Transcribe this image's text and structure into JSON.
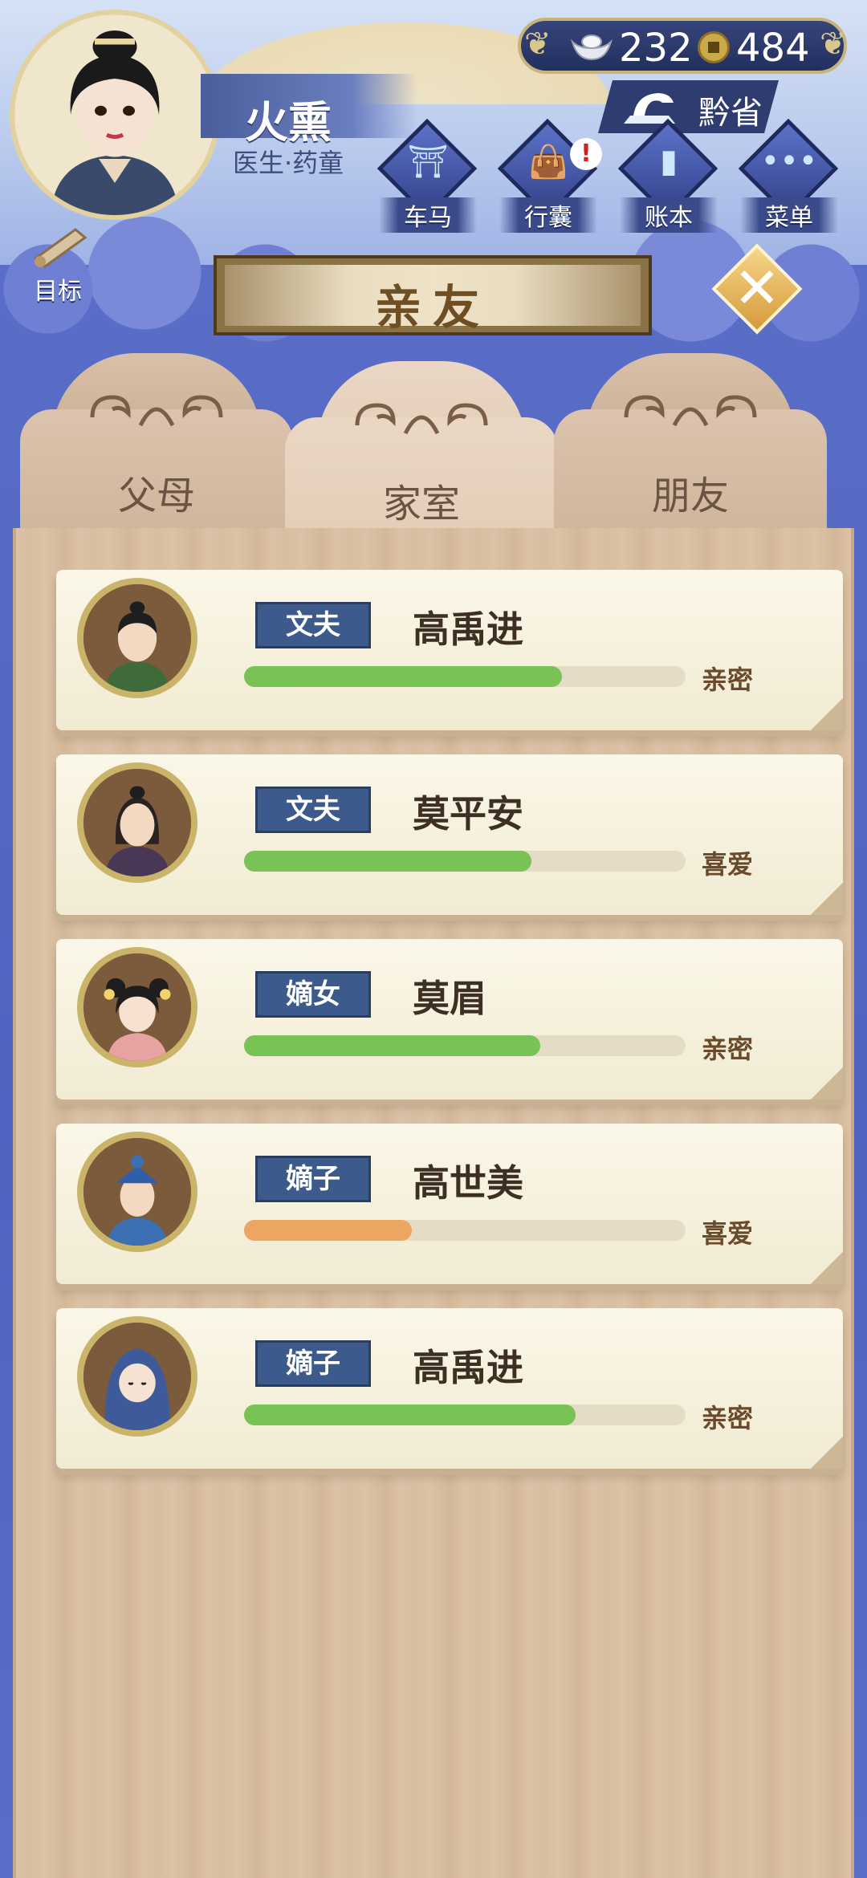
{
  "player": {
    "name": "火熏",
    "title": "医生·药童"
  },
  "currency": {
    "silver": "232",
    "gold": "484"
  },
  "province": "黔省",
  "menu": [
    {
      "label": "车马",
      "icon": "carriage-icon"
    },
    {
      "label": "行囊",
      "icon": "bag-icon",
      "alert": "!"
    },
    {
      "label": "账本",
      "icon": "ledger-icon"
    },
    {
      "label": "菜单",
      "icon": "more-icon"
    }
  ],
  "goal_label": "目标",
  "page_title": "亲友",
  "tabs": [
    {
      "label": "父母",
      "active": false
    },
    {
      "label": "家室",
      "active": true
    },
    {
      "label": "朋友",
      "active": false
    }
  ],
  "relatives": [
    {
      "role": "文夫",
      "name": "高禹进",
      "level": "亲密",
      "progress": 0.72,
      "bar_color": "#79c255"
    },
    {
      "role": "文夫",
      "name": "莫平安",
      "level": "喜爱",
      "progress": 0.65,
      "bar_color": "#79c255"
    },
    {
      "role": "嫡女",
      "name": "莫眉",
      "level": "亲密",
      "progress": 0.67,
      "bar_color": "#79c255"
    },
    {
      "role": "嫡子",
      "name": "高世美",
      "level": "喜爱",
      "progress": 0.38,
      "bar_color": "#eda661"
    },
    {
      "role": "嫡子",
      "name": "高禹进",
      "level": "亲密",
      "progress": 0.75,
      "bar_color": "#79c255"
    }
  ]
}
